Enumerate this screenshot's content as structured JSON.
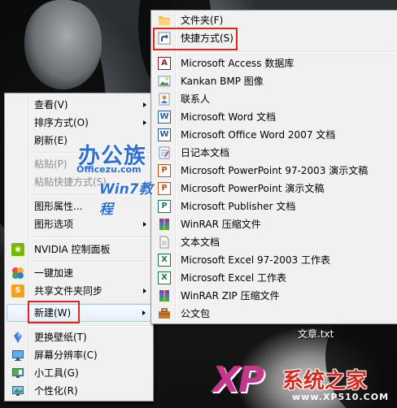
{
  "desktop": {
    "file_label": "文章.txt"
  },
  "context_menu": {
    "items": [
      {
        "label": "查看(V)",
        "submenu": true
      },
      {
        "label": "排序方式(O)",
        "submenu": true
      },
      {
        "label": "刷新(E)"
      },
      {
        "label": "粘贴(P)",
        "disabled": true
      },
      {
        "label": "粘贴快捷方式(S)",
        "disabled": true
      },
      {
        "label": "图形属性..."
      },
      {
        "label": "图形选项",
        "submenu": true
      },
      {
        "label": "NVIDIA 控制面板",
        "icon": "nvidia-icon"
      },
      {
        "label": "一键加速",
        "icon": "accelerate-icon"
      },
      {
        "label": "共享文件夹同步",
        "icon": "sync-icon",
        "submenu": true
      },
      {
        "label": "新建(W)",
        "submenu": true,
        "highlighted": true
      },
      {
        "label": "更换壁纸(T)",
        "icon": "wallpaper-icon"
      },
      {
        "label": "屏幕分辨率(C)",
        "icon": "display-icon"
      },
      {
        "label": "小工具(G)",
        "icon": "gadgets-icon"
      },
      {
        "label": "个性化(R)",
        "icon": "personalize-icon"
      }
    ]
  },
  "new_submenu": {
    "items": [
      {
        "label": "文件夹(F)",
        "icon": "folder-icon"
      },
      {
        "label": "快捷方式(S)",
        "icon": "shortcut-icon",
        "highlighted": true
      },
      {
        "label": "Microsoft Access 数据库",
        "icon": "access-icon"
      },
      {
        "label": "Kankan BMP 图像",
        "icon": "image-icon"
      },
      {
        "label": "联系人",
        "icon": "contact-icon"
      },
      {
        "label": "Microsoft Word 文档",
        "icon": "word-icon"
      },
      {
        "label": "Microsoft Office Word 2007 文档",
        "icon": "word-icon"
      },
      {
        "label": "日记本文档",
        "icon": "journal-icon"
      },
      {
        "label": "Microsoft PowerPoint 97-2003 演示文稿",
        "icon": "powerpoint-icon"
      },
      {
        "label": "Microsoft PowerPoint 演示文稿",
        "icon": "powerpoint-icon"
      },
      {
        "label": "Microsoft Publisher 文档",
        "icon": "publisher-icon"
      },
      {
        "label": "WinRAR 压缩文件",
        "icon": "winrar-icon"
      },
      {
        "label": "文本文档",
        "icon": "text-document-icon"
      },
      {
        "label": "Microsoft Excel 97-2003 工作表",
        "icon": "excel-icon"
      },
      {
        "label": "Microsoft Excel 工作表",
        "icon": "excel-icon"
      },
      {
        "label": "WinRAR ZIP 压缩文件",
        "icon": "winrar-zip-icon"
      },
      {
        "label": "公文包",
        "icon": "briefcase-icon"
      }
    ]
  },
  "watermarks": {
    "site1_title": "办公族",
    "site1_domain": "Officezu.com",
    "site1_sub": "Win7教程",
    "site2_logo": "XP",
    "site2_title": "系统之家",
    "site2_domain": "www.XP510.COM"
  },
  "colors": {
    "menu_bg": "#f1f1f1",
    "highlight_border": "#e0261c",
    "watermark_blue": "#2f6fd1",
    "watermark_red": "#d8261c",
    "xp_logo_magenta": "#c8358d"
  }
}
